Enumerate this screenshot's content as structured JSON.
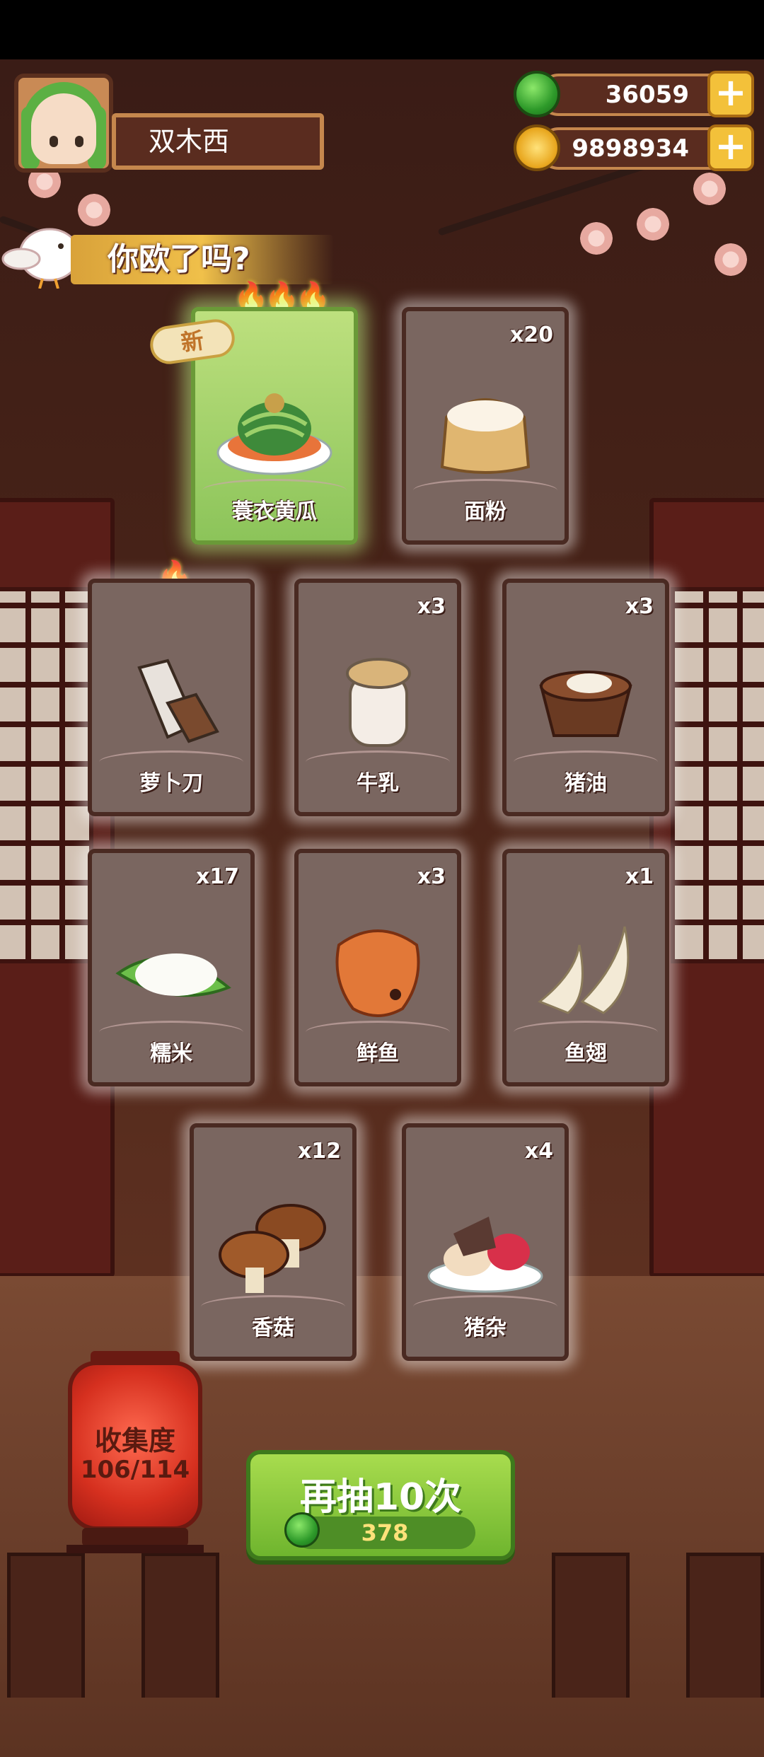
{
  "player": {
    "name": "双木西"
  },
  "resources": {
    "jade": "36059",
    "coins": "9898934"
  },
  "banner": {
    "text": "你欧了吗?"
  },
  "new_tag": "新",
  "cards": [
    {
      "name": "蓑衣黄瓜",
      "count": "",
      "icon": "cucumber-dish-icon",
      "flames": "🔥🔥🔥",
      "featured": true,
      "is_new": true
    },
    {
      "name": "面粉",
      "count": "x20",
      "icon": "flour-sack-icon",
      "flames": ""
    },
    {
      "name": "萝卜刀",
      "count": "",
      "icon": "radish-knife-icon",
      "flames": "🔥"
    },
    {
      "name": "牛乳",
      "count": "x3",
      "icon": "milk-jar-icon",
      "flames": ""
    },
    {
      "name": "猪油",
      "count": "x3",
      "icon": "lard-bowl-icon",
      "flames": ""
    },
    {
      "name": "糯米",
      "count": "x17",
      "icon": "sticky-rice-icon",
      "flames": ""
    },
    {
      "name": "鲜鱼",
      "count": "x3",
      "icon": "fish-icon",
      "flames": ""
    },
    {
      "name": "鱼翅",
      "count": "x1",
      "icon": "shark-fin-icon",
      "flames": ""
    },
    {
      "name": "香菇",
      "count": "x12",
      "icon": "mushroom-icon",
      "flames": ""
    },
    {
      "name": "猪杂",
      "count": "x4",
      "icon": "pork-offal-icon",
      "flames": ""
    }
  ],
  "collection": {
    "label": "收集度",
    "value": "106/114"
  },
  "draw_button": {
    "label": "再抽10次",
    "cost": "378"
  },
  "colors": {
    "card_bg": "#7a6660",
    "featured_bg": "#a8d46a",
    "draw_green": "#6fb52e",
    "gold": "#f3c13a"
  }
}
